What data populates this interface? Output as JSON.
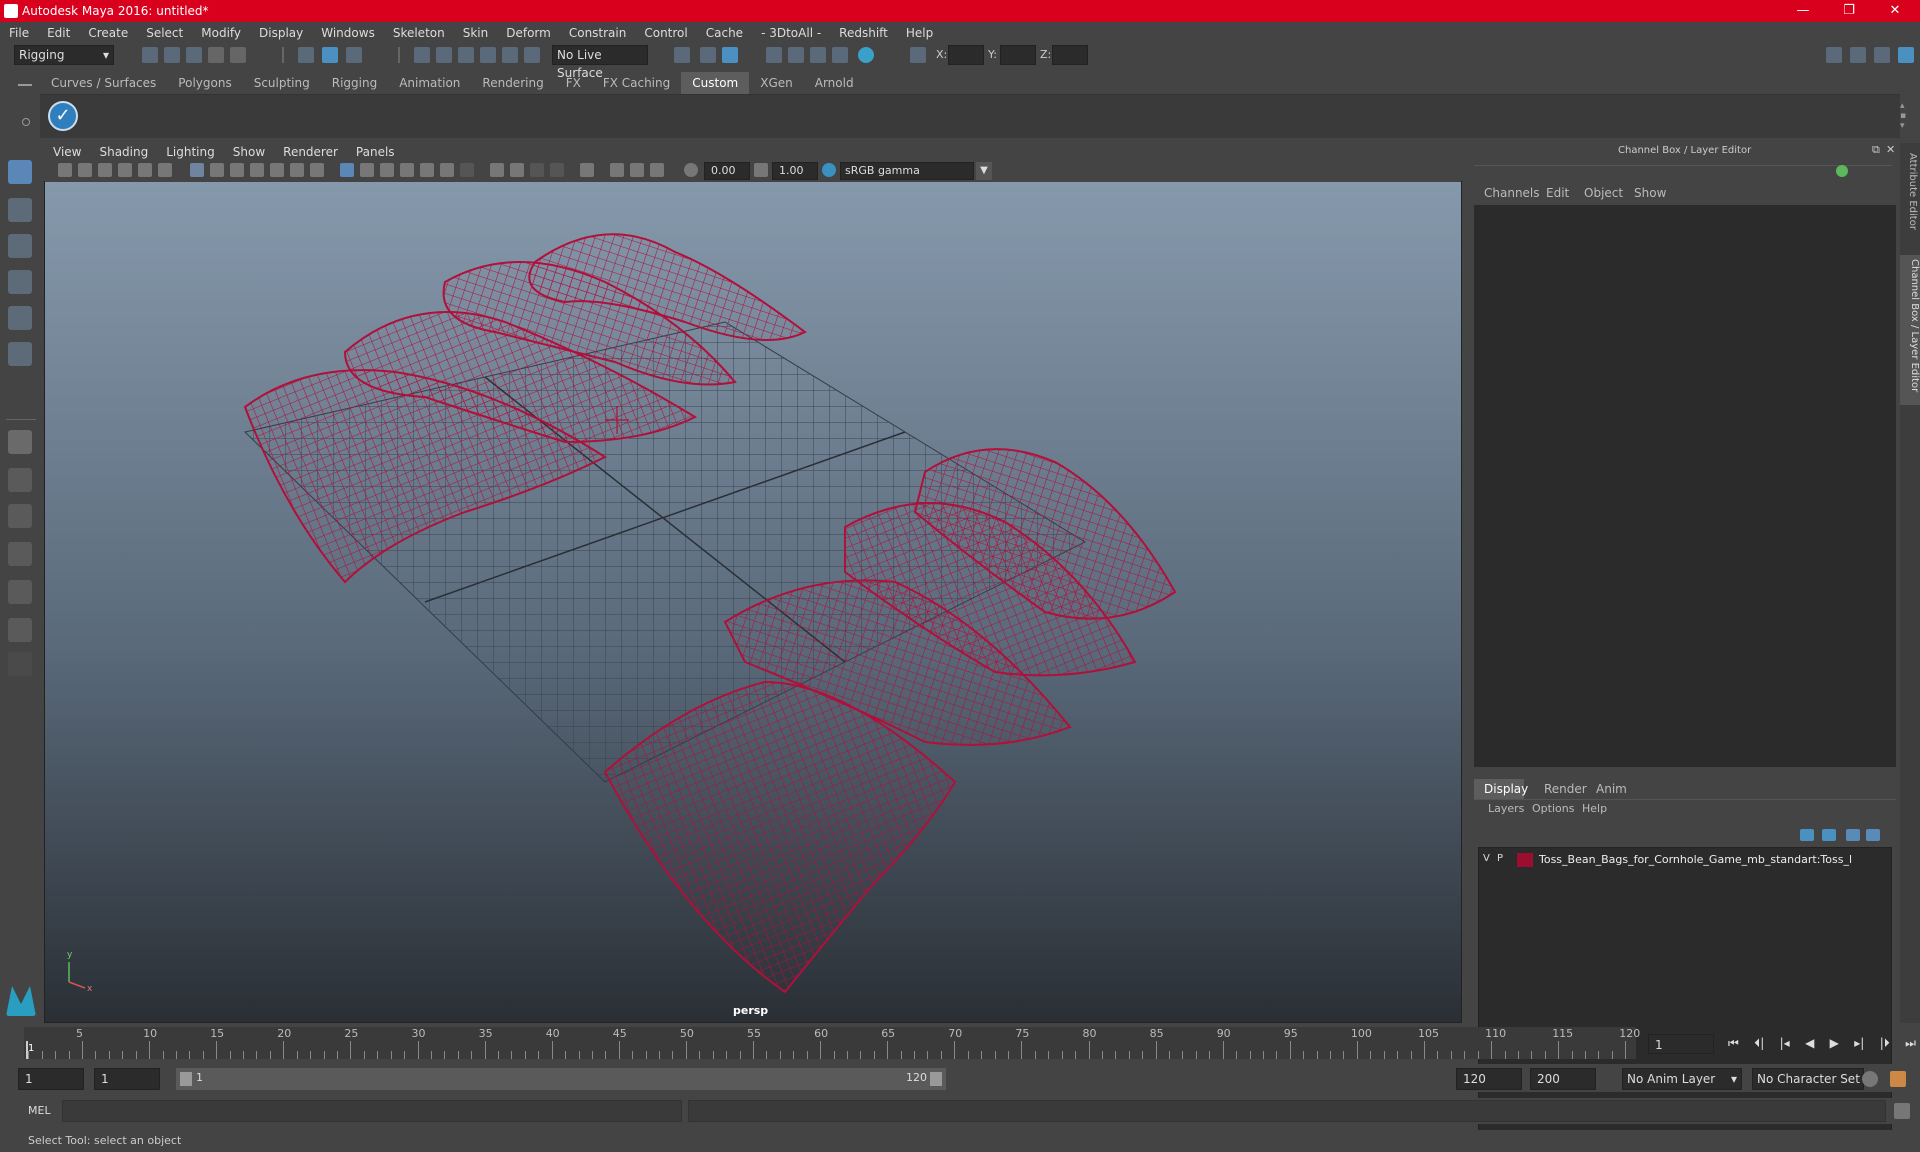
{
  "window": {
    "title": "Autodesk Maya 2016: untitled*",
    "controls": [
      "—",
      "❐",
      "✕"
    ]
  },
  "menubar": [
    "File",
    "Edit",
    "Create",
    "Select",
    "Modify",
    "Display",
    "Windows",
    "Skeleton",
    "Skin",
    "Deform",
    "Constrain",
    "Control",
    "Cache",
    "- 3DtoAll -",
    "Redshift",
    "Help"
  ],
  "toolbar": {
    "mode": "Rigging",
    "live_surface": "No Live Surface",
    "x_label": "X:",
    "y_label": "Y:",
    "z_label": "Z:"
  },
  "shelf_tabs": [
    "Curves / Surfaces",
    "Polygons",
    "Sculpting",
    "Rigging",
    "Animation",
    "Rendering",
    "FX",
    "FX Caching",
    "Custom",
    "XGen",
    "Arnold"
  ],
  "shelf_active": "Custom",
  "viewport": {
    "menu": [
      "View",
      "Shading",
      "Lighting",
      "Show",
      "Renderer",
      "Panels"
    ],
    "exposure": "0.00",
    "gamma": "1.00",
    "color_space": "sRGB gamma",
    "camera": "persp",
    "axis_y": "y",
    "axis_x": "x"
  },
  "channel_box": {
    "title": "Channel Box / Layer Editor",
    "menu": [
      "Channels",
      "Edit",
      "Object",
      "Show"
    ],
    "side_tabs": [
      "Attribute Editor",
      "Channel Box / Layer Editor"
    ]
  },
  "layer_editor": {
    "tabs": [
      "Display",
      "Render",
      "Anim"
    ],
    "active_tab": "Display",
    "menu": [
      "Layers",
      "Options",
      "Help"
    ],
    "layers": [
      {
        "v": "V",
        "p": "P",
        "name": "Toss_Bean_Bags_for_Cornhole_Game_mb_standart:Toss_l",
        "color": "#9b0e2f"
      }
    ]
  },
  "timeline": {
    "ticks": [
      "5",
      "10",
      "15",
      "20",
      "25",
      "30",
      "35",
      "40",
      "45",
      "50",
      "55",
      "60",
      "65",
      "70",
      "75",
      "80",
      "85",
      "90",
      "95",
      "100",
      "105",
      "110",
      "115",
      "120"
    ],
    "current_marker": "1",
    "current_frame": "1"
  },
  "range": {
    "start": "1",
    "playback_start": "1",
    "slider_start": "1",
    "slider_end": "120",
    "playback_end": "120",
    "end": "200",
    "anim_layer": "No Anim Layer",
    "character_set": "No Character Set"
  },
  "cmdline": {
    "label": "MEL"
  },
  "status": "Select Tool: select an object",
  "colors": {
    "title_red": "#d9001d",
    "wire": "#b0103a",
    "ui_bg": "#444444"
  }
}
